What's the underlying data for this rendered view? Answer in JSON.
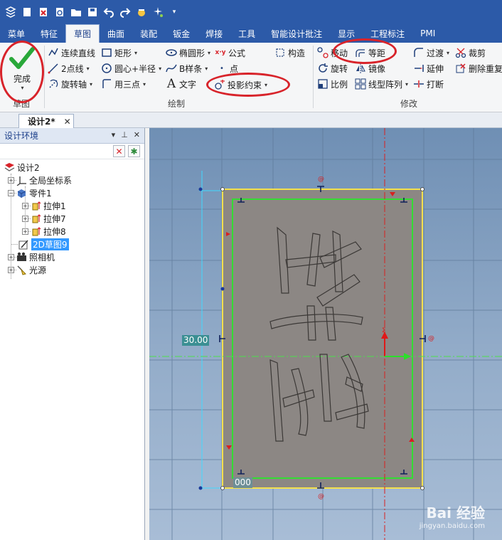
{
  "tabs": [
    "菜单",
    "特征",
    "草图",
    "曲面",
    "装配",
    "钣金",
    "焊接",
    "工具",
    "智能设计批注",
    "显示",
    "工程标注",
    "PMI"
  ],
  "active_tab": "草图",
  "ribbon": {
    "done_label": "完成",
    "group_sketch": "草图",
    "group_draw": "绘制",
    "group_modify": "修改",
    "continuous_line": "连续直线",
    "rectangle": "矩形",
    "ellipse": "椭圆形",
    "formula": "公式",
    "construct": "构造",
    "two_point_line": "2点线",
    "center_radius": "圆心+半径",
    "bspline": "B样条",
    "point": "点",
    "rotate_axis": "旋转轴",
    "three_point": "用三点",
    "text": "文字",
    "project_constraint": "投影约束",
    "move": "移动",
    "offset": "等距",
    "transition": "过渡",
    "trim": "裁剪",
    "rotate": "旋转",
    "mirror": "镜像",
    "extend": "延伸",
    "delete_duplicate": "删除重复",
    "scale": "比例",
    "linear_array": "线型阵列",
    "break": "打断"
  },
  "document_tab": "设计2*",
  "panel": {
    "title": "设计环境",
    "tree": {
      "root": "设计2",
      "global_coord": "全局坐标系",
      "part": "零件1",
      "extrude1": "拉伸1",
      "extrude7": "拉伸7",
      "extrude8": "拉伸8",
      "sketch": "2D草图9",
      "camera": "照相机",
      "light": "光源"
    }
  },
  "viewport": {
    "dim_left": "30.00",
    "dim_bottom": "000",
    "watermark": "Bai 经验",
    "watermark_sub": "jingyan.baidu.com"
  },
  "colors": {
    "ribbon_blue": "#2c5aa8",
    "annotation_red": "#d8232a",
    "selection": "#3399ff",
    "sketch_fill": "#8c8784",
    "yellow_outline": "#f4e04d",
    "green_outline": "#33dd33"
  }
}
